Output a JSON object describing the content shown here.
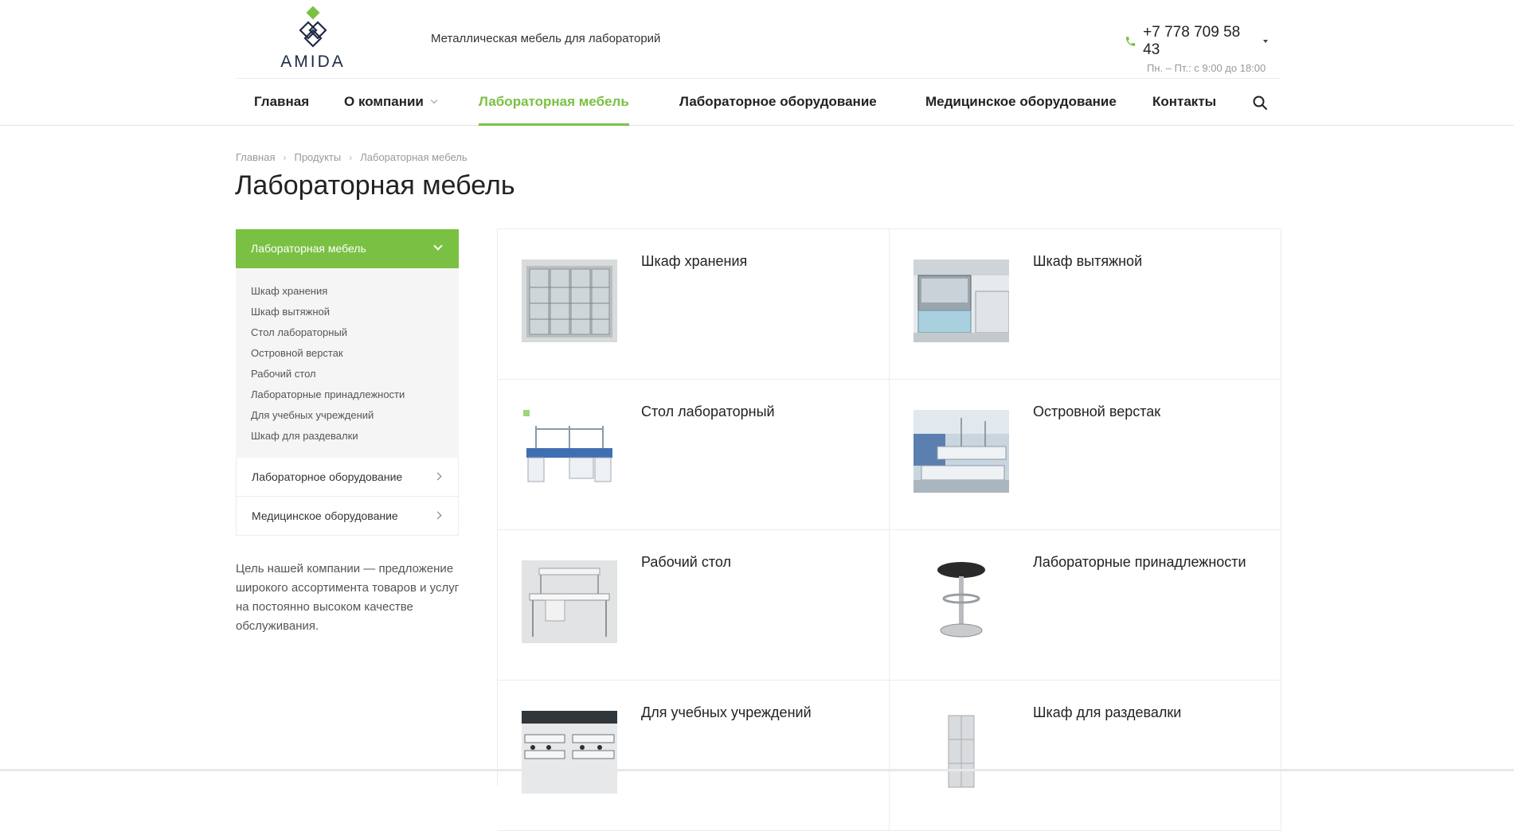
{
  "header": {
    "logo_text": "AMIDA",
    "tagline": "Металлическая мебель для лабораторий",
    "phone": "+7 778 709 58 43",
    "hours": "Пн. – Пт.: с 9:00 до 18:00"
  },
  "nav": {
    "items": [
      {
        "label": "Главная"
      },
      {
        "label": "О компании"
      },
      {
        "label": "Лабораторная мебель"
      },
      {
        "label": "Лабораторное оборудование"
      },
      {
        "label": "Медицинское оборудование"
      },
      {
        "label": "Контакты"
      }
    ],
    "active": "Лабораторная мебель"
  },
  "breadcrumb": [
    "Главная",
    "Продукты",
    "Лабораторная мебель"
  ],
  "page_title": "Лабораторная мебель",
  "sidebar": {
    "active_section": "Лабораторная мебель",
    "sub_items": [
      "Шкаф хранения",
      "Шкаф вытяжной",
      "Стол лабораторный",
      "Островной верстак",
      "Рабочий стол",
      "Лабораторные принадлежности",
      "Для учебных учреждений",
      "Шкаф для раздевалки"
    ],
    "other_sections": [
      "Лабораторное оборудование",
      "Медицинское оборудование"
    ],
    "about_text": "Цель нашей компании — предложение широкого ассортимента товаров и услуг на постоянно высоком качестве обслуживания."
  },
  "products": [
    {
      "title": "Шкаф хранения"
    },
    {
      "title": "Шкаф вытяжной"
    },
    {
      "title": "Стол лабораторный"
    },
    {
      "title": "Островной верстак"
    },
    {
      "title": "Рабочий стол"
    },
    {
      "title": "Лабораторные принадлежности"
    },
    {
      "title": "Для учебных учреждений"
    },
    {
      "title": "Шкаф для раздевалки"
    }
  ],
  "colors": {
    "accent": "#7ac143",
    "logo_navy": "#1f2a44"
  }
}
